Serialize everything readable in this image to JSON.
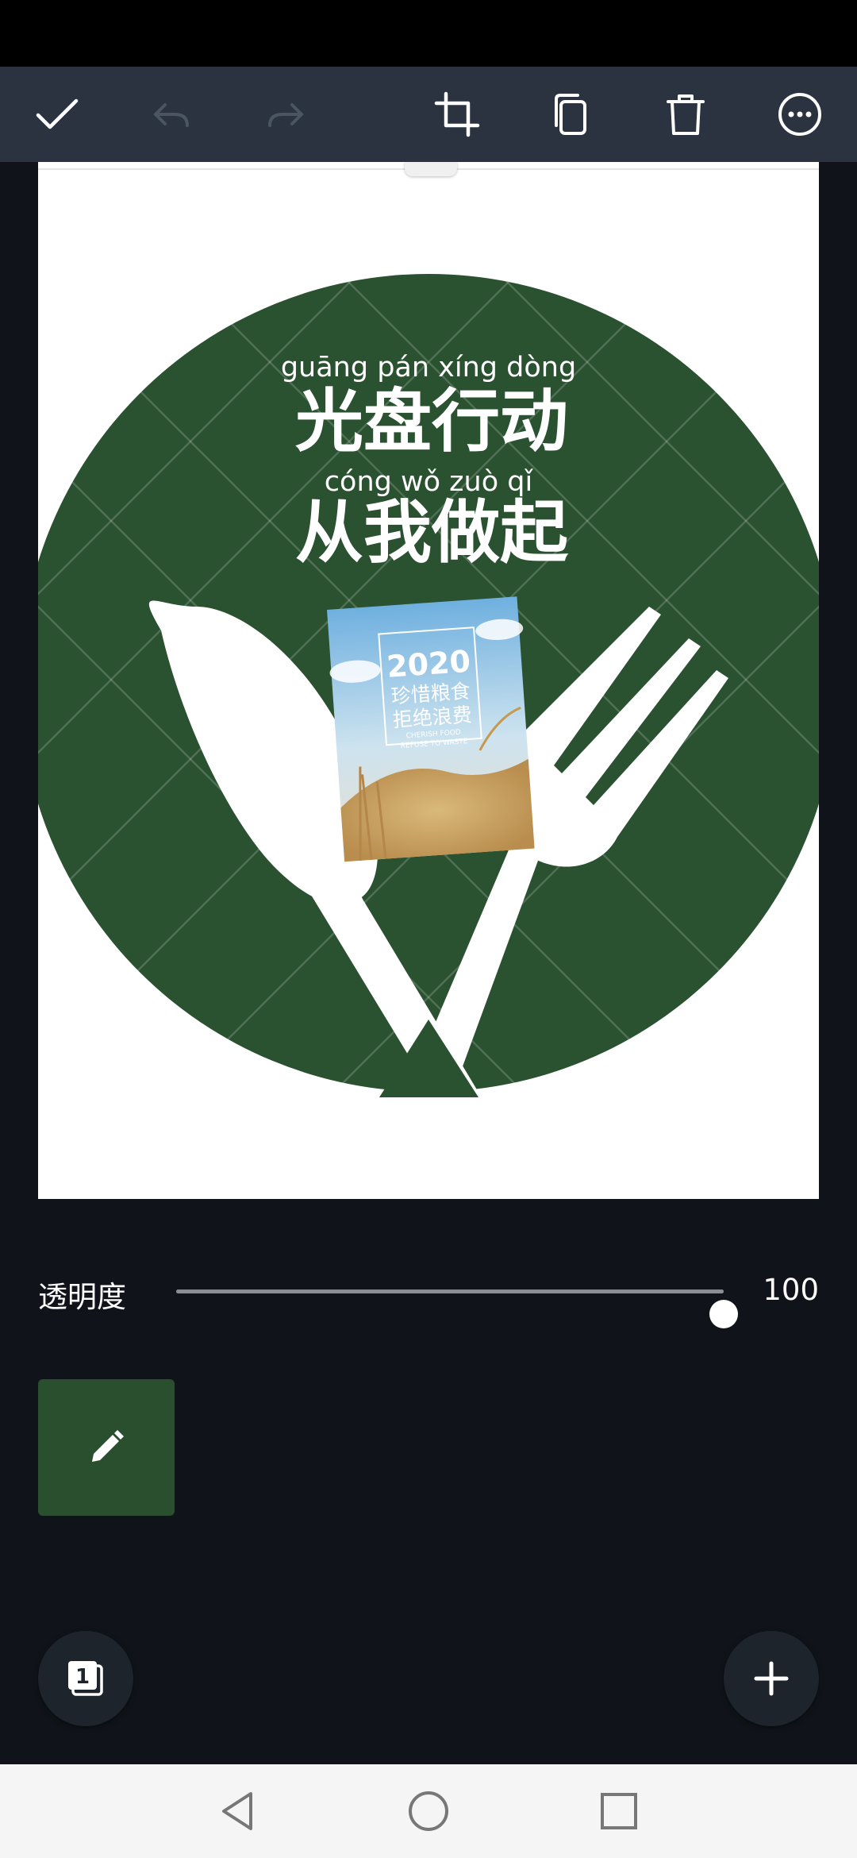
{
  "toolbar": {
    "confirm_icon": "check-icon",
    "undo_icon": "undo-icon",
    "redo_icon": "redo-icon",
    "crop_icon": "crop-icon",
    "duplicate_icon": "duplicate-icon",
    "delete_icon": "trash-icon",
    "more_icon": "more-icon"
  },
  "canvas": {
    "pinyin_line1": "guāng pán  xíng  dòng",
    "title_line1": "光盘行动",
    "pinyin_line2": "cóng  wǒ  zuò  qǐ",
    "title_line2": "从我做起",
    "sticker": {
      "year": "2020",
      "line1": "珍惜粮食",
      "line2": "拒绝浪费",
      "en_line1": "CHERISH FOOD",
      "en_line2": "REFUSE TO WASTE"
    },
    "colors": {
      "circle": "#2a5130",
      "background": "#ffffff"
    }
  },
  "opacity": {
    "label": "透明度",
    "value": "100",
    "level": 1.0
  },
  "color_swatch": {
    "color": "#2a4f2e",
    "icon": "pencil-icon"
  },
  "pages": {
    "count": "1",
    "icon": "pages-icon"
  },
  "add_button_icon": "plus-icon",
  "navbar": {
    "back_icon": "back-triangle-icon",
    "home_icon": "home-circle-icon",
    "recents_icon": "recents-square-icon"
  }
}
